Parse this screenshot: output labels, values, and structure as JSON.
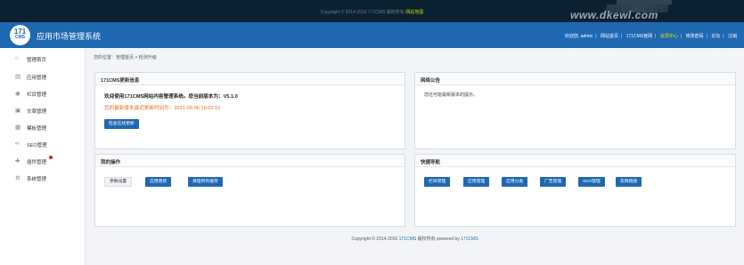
{
  "topbar": {
    "copyright": "Copyright © 2014-2016 171CMS 版权所有",
    "link": "网站地图"
  },
  "header": {
    "logo_top": "171",
    "logo_bottom": "CMS",
    "title": "应用市场管理系统",
    "nav": [
      {
        "label": "欢迎您, admin",
        "highlight": false
      },
      {
        "label": "网站首页",
        "highlight": false
      },
      {
        "label": "171CMS官网",
        "highlight": false
      },
      {
        "label": "会员中心",
        "highlight": true
      },
      {
        "label": "修改密码",
        "highlight": false
      },
      {
        "label": "论坛",
        "highlight": false
      },
      {
        "label": "注销",
        "highlight": false
      }
    ]
  },
  "sidebar": {
    "items": [
      {
        "label": "管理首页",
        "icon": "⌂",
        "icon_name": "home-icon"
      },
      {
        "label": "应用管理",
        "icon": "▤",
        "icon_name": "app-icon"
      },
      {
        "label": "栏目管理",
        "icon": "◉",
        "icon_name": "column-icon"
      },
      {
        "label": "文章管理",
        "icon": "▣",
        "icon_name": "article-icon"
      },
      {
        "label": "模板管理",
        "icon": "▦",
        "icon_name": "template-icon"
      },
      {
        "label": "SEO管理",
        "icon": "∞",
        "icon_name": "seo-icon"
      },
      {
        "label": "插件管理",
        "icon": "✚",
        "icon_name": "plugin-icon",
        "badge": true
      },
      {
        "label": "系统管理",
        "icon": "⚙",
        "icon_name": "gear-icon"
      }
    ]
  },
  "breadcrumb": "您的位置：管理首页 > 检测升级",
  "update_panel": {
    "title": "171CMS更新信息",
    "welcome": "欢迎使用171CMS网站内容管理系统。您当前版本为：V5.1.0",
    "latest": "您的最新版本最近更新时间为：2021-09-06 15:02:10",
    "button": "检查在线更新"
  },
  "notice_panel": {
    "title": "网络公告",
    "text": "您还可能最新版本的提示。"
  },
  "ops_panel": {
    "title": "我的操作",
    "buttons": [
      "参数设置",
      "应用更新",
      "清理所有缓存"
    ]
  },
  "quick_panel": {
    "title": "快捷导航",
    "buttons": [
      "栏目管理",
      "应用管理",
      "应用分类",
      "广告管理",
      "SEO管理",
      "友情链接"
    ]
  },
  "footer": {
    "prefix": "Copyright © 2014-2016",
    "brand": "171CMS",
    "middle": "版权所有 powered by",
    "powered": "171CMS"
  },
  "colors": {
    "accent": "#1f68b2",
    "topbar": "#0b2131",
    "highlight": "#ffde00",
    "badge": "#e2231a"
  }
}
